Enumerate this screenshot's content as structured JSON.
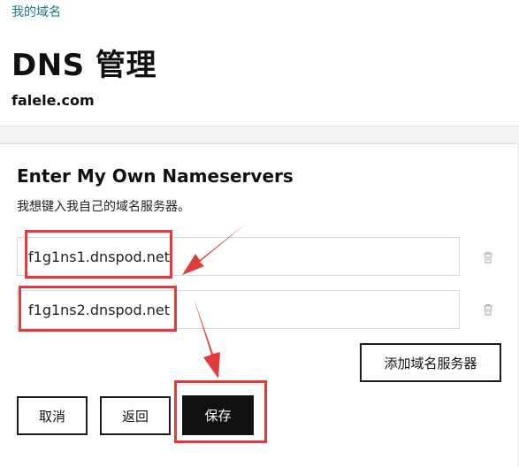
{
  "breadcrumb": "我的域名",
  "page": {
    "title": "DNS 管理",
    "domain": "falele.com"
  },
  "section": {
    "heading": "Enter My Own Nameservers",
    "description": "我想键入我自己的域名服务器。"
  },
  "nameservers": [
    {
      "value": "f1g1ns1.dnspod.net"
    },
    {
      "value": "f1g1ns2.dnspod.net"
    }
  ],
  "buttons": {
    "add_nameserver": "添加域名服务器",
    "cancel": "取消",
    "back": "返回",
    "save": "保存"
  },
  "icons": {
    "delete": "trash-icon"
  },
  "colors": {
    "link": "#1b7a82",
    "primary_button": "#111111",
    "annotation": "#e23b3b"
  }
}
